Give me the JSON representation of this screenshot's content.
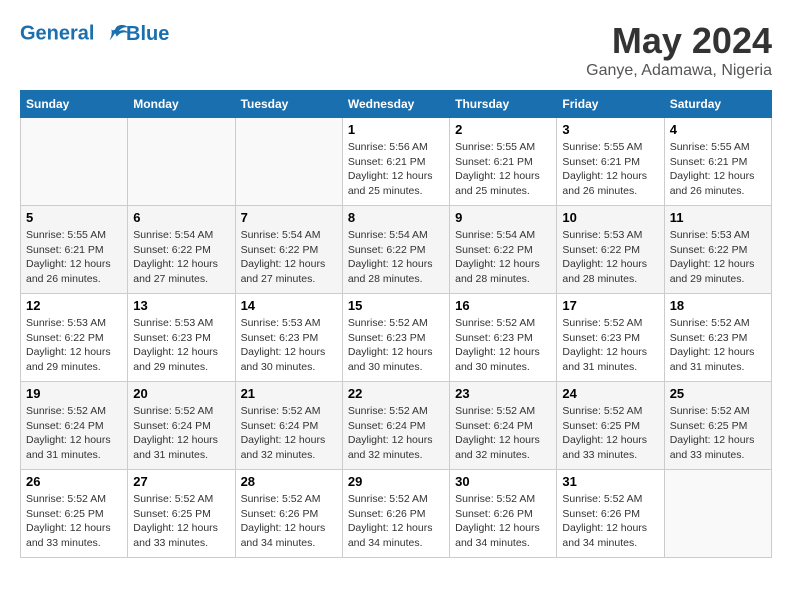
{
  "logo": {
    "line1": "General",
    "line2": "Blue"
  },
  "title": "May 2024",
  "subtitle": "Ganye, Adamawa, Nigeria",
  "days_of_week": [
    "Sunday",
    "Monday",
    "Tuesday",
    "Wednesday",
    "Thursday",
    "Friday",
    "Saturday"
  ],
  "weeks": [
    [
      {
        "day": "",
        "info": ""
      },
      {
        "day": "",
        "info": ""
      },
      {
        "day": "",
        "info": ""
      },
      {
        "day": "1",
        "info": "Sunrise: 5:56 AM\nSunset: 6:21 PM\nDaylight: 12 hours\nand 25 minutes."
      },
      {
        "day": "2",
        "info": "Sunrise: 5:55 AM\nSunset: 6:21 PM\nDaylight: 12 hours\nand 25 minutes."
      },
      {
        "day": "3",
        "info": "Sunrise: 5:55 AM\nSunset: 6:21 PM\nDaylight: 12 hours\nand 26 minutes."
      },
      {
        "day": "4",
        "info": "Sunrise: 5:55 AM\nSunset: 6:21 PM\nDaylight: 12 hours\nand 26 minutes."
      }
    ],
    [
      {
        "day": "5",
        "info": "Sunrise: 5:55 AM\nSunset: 6:21 PM\nDaylight: 12 hours\nand 26 minutes."
      },
      {
        "day": "6",
        "info": "Sunrise: 5:54 AM\nSunset: 6:22 PM\nDaylight: 12 hours\nand 27 minutes."
      },
      {
        "day": "7",
        "info": "Sunrise: 5:54 AM\nSunset: 6:22 PM\nDaylight: 12 hours\nand 27 minutes."
      },
      {
        "day": "8",
        "info": "Sunrise: 5:54 AM\nSunset: 6:22 PM\nDaylight: 12 hours\nand 28 minutes."
      },
      {
        "day": "9",
        "info": "Sunrise: 5:54 AM\nSunset: 6:22 PM\nDaylight: 12 hours\nand 28 minutes."
      },
      {
        "day": "10",
        "info": "Sunrise: 5:53 AM\nSunset: 6:22 PM\nDaylight: 12 hours\nand 28 minutes."
      },
      {
        "day": "11",
        "info": "Sunrise: 5:53 AM\nSunset: 6:22 PM\nDaylight: 12 hours\nand 29 minutes."
      }
    ],
    [
      {
        "day": "12",
        "info": "Sunrise: 5:53 AM\nSunset: 6:22 PM\nDaylight: 12 hours\nand 29 minutes."
      },
      {
        "day": "13",
        "info": "Sunrise: 5:53 AM\nSunset: 6:23 PM\nDaylight: 12 hours\nand 29 minutes."
      },
      {
        "day": "14",
        "info": "Sunrise: 5:53 AM\nSunset: 6:23 PM\nDaylight: 12 hours\nand 30 minutes."
      },
      {
        "day": "15",
        "info": "Sunrise: 5:52 AM\nSunset: 6:23 PM\nDaylight: 12 hours\nand 30 minutes."
      },
      {
        "day": "16",
        "info": "Sunrise: 5:52 AM\nSunset: 6:23 PM\nDaylight: 12 hours\nand 30 minutes."
      },
      {
        "day": "17",
        "info": "Sunrise: 5:52 AM\nSunset: 6:23 PM\nDaylight: 12 hours\nand 31 minutes."
      },
      {
        "day": "18",
        "info": "Sunrise: 5:52 AM\nSunset: 6:23 PM\nDaylight: 12 hours\nand 31 minutes."
      }
    ],
    [
      {
        "day": "19",
        "info": "Sunrise: 5:52 AM\nSunset: 6:24 PM\nDaylight: 12 hours\nand 31 minutes."
      },
      {
        "day": "20",
        "info": "Sunrise: 5:52 AM\nSunset: 6:24 PM\nDaylight: 12 hours\nand 31 minutes."
      },
      {
        "day": "21",
        "info": "Sunrise: 5:52 AM\nSunset: 6:24 PM\nDaylight: 12 hours\nand 32 minutes."
      },
      {
        "day": "22",
        "info": "Sunrise: 5:52 AM\nSunset: 6:24 PM\nDaylight: 12 hours\nand 32 minutes."
      },
      {
        "day": "23",
        "info": "Sunrise: 5:52 AM\nSunset: 6:24 PM\nDaylight: 12 hours\nand 32 minutes."
      },
      {
        "day": "24",
        "info": "Sunrise: 5:52 AM\nSunset: 6:25 PM\nDaylight: 12 hours\nand 33 minutes."
      },
      {
        "day": "25",
        "info": "Sunrise: 5:52 AM\nSunset: 6:25 PM\nDaylight: 12 hours\nand 33 minutes."
      }
    ],
    [
      {
        "day": "26",
        "info": "Sunrise: 5:52 AM\nSunset: 6:25 PM\nDaylight: 12 hours\nand 33 minutes."
      },
      {
        "day": "27",
        "info": "Sunrise: 5:52 AM\nSunset: 6:25 PM\nDaylight: 12 hours\nand 33 minutes."
      },
      {
        "day": "28",
        "info": "Sunrise: 5:52 AM\nSunset: 6:26 PM\nDaylight: 12 hours\nand 34 minutes."
      },
      {
        "day": "29",
        "info": "Sunrise: 5:52 AM\nSunset: 6:26 PM\nDaylight: 12 hours\nand 34 minutes."
      },
      {
        "day": "30",
        "info": "Sunrise: 5:52 AM\nSunset: 6:26 PM\nDaylight: 12 hours\nand 34 minutes."
      },
      {
        "day": "31",
        "info": "Sunrise: 5:52 AM\nSunset: 6:26 PM\nDaylight: 12 hours\nand 34 minutes."
      },
      {
        "day": "",
        "info": ""
      }
    ]
  ]
}
